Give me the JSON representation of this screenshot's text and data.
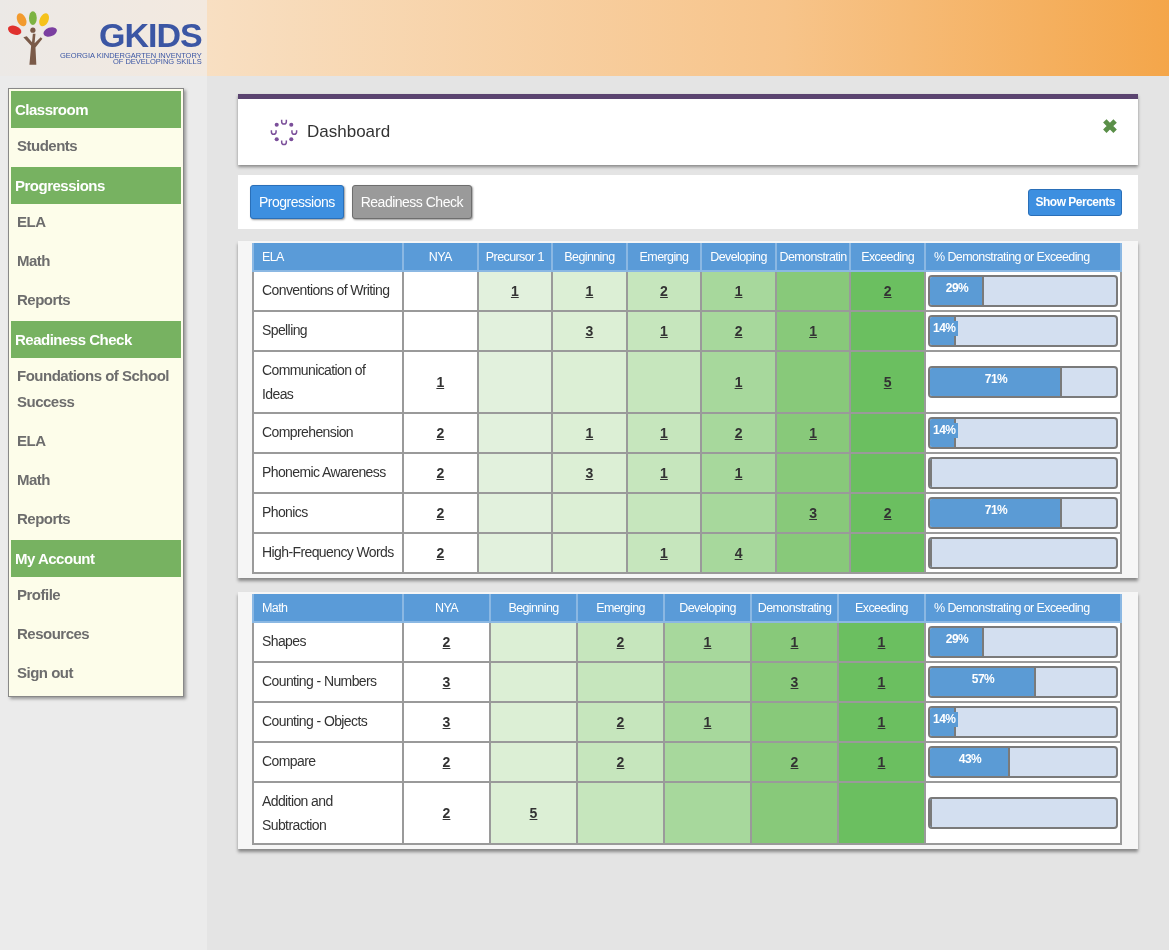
{
  "logo": {
    "title": "GKIDS",
    "subtitle": [
      "GEORGIA KINDERGARTEN INVENTORY",
      "OF DEVELOPING SKILLS"
    ]
  },
  "sidebar": {
    "items": [
      {
        "kind": "header",
        "label": "Classroom"
      },
      {
        "kind": "link",
        "label": "Students"
      },
      {
        "kind": "header",
        "label": "Progressions"
      },
      {
        "kind": "link",
        "label": "ELA"
      },
      {
        "kind": "link",
        "label": "Math"
      },
      {
        "kind": "link",
        "label": "Reports"
      },
      {
        "kind": "header",
        "label": "Readiness Check"
      },
      {
        "kind": "link",
        "label": "Foundations of School Success"
      },
      {
        "kind": "link",
        "label": "ELA"
      },
      {
        "kind": "link",
        "label": "Math"
      },
      {
        "kind": "link",
        "label": "Reports"
      },
      {
        "kind": "header",
        "label": "My Account"
      },
      {
        "kind": "link",
        "label": "Profile"
      },
      {
        "kind": "link",
        "label": "Resources"
      },
      {
        "kind": "link",
        "label": "Sign out"
      }
    ]
  },
  "panel": {
    "title": "Dashboard",
    "close": "✖"
  },
  "tabs": [
    {
      "label": "Progressions",
      "selected": true
    },
    {
      "label": "Readiness Check",
      "selected": false
    }
  ],
  "show_percents": "Show Percents",
  "tables": [
    {
      "columns": [
        "ELA",
        "NYA",
        "Precursor 1",
        "Beginning",
        "Emerging",
        "Developing",
        "Demonstratin",
        "Exceeding",
        "% Demonstrating or Exceeding"
      ],
      "rows": [
        {
          "cells": [
            "Conventions of Writing",
            null,
            "1",
            "1",
            "2",
            "1",
            null,
            "2"
          ],
          "percent": {
            "level": 0.29,
            "label": "29%"
          }
        },
        {
          "cells": [
            "Spelling",
            null,
            null,
            "3",
            "1",
            "2",
            "1",
            null
          ],
          "percent": {
            "level": 0.14,
            "label": "14%"
          }
        },
        {
          "cells": [
            "Communication of Ideas",
            "1",
            null,
            null,
            null,
            "1",
            null,
            "5"
          ],
          "percent": {
            "level": 0.71,
            "label": "71%"
          }
        },
        {
          "cells": [
            "Comprehension",
            "2",
            null,
            "1",
            "1",
            "2",
            "1",
            null
          ],
          "percent": {
            "level": 0.14,
            "label": "14%"
          }
        },
        {
          "cells": [
            "Phonemic Awareness",
            "2",
            null,
            "3",
            "1",
            "1",
            null,
            null
          ],
          "percent": {
            "level": 0
          }
        },
        {
          "cells": [
            "Phonics",
            "2",
            null,
            null,
            null,
            null,
            "3",
            "2"
          ],
          "percent": {
            "level": 0.71,
            "label": "71%"
          }
        },
        {
          "cells": [
            "High-Frequency Words",
            "2",
            null,
            null,
            "1",
            "4",
            null,
            null
          ],
          "percent": {
            "level": 0
          }
        }
      ]
    },
    {
      "columns": [
        "Math",
        "NYA",
        "Beginning",
        "Emerging",
        "Developing",
        "Demonstrating",
        "Exceeding",
        "% Demonstrating or Exceeding"
      ],
      "rows": [
        {
          "cells": [
            "Shapes",
            "2",
            null,
            "2",
            "1",
            "1",
            "1"
          ],
          "percent": {
            "level": 0.29,
            "label": "29%"
          }
        },
        {
          "cells": [
            "Counting - Numbers",
            "3",
            null,
            null,
            null,
            "3",
            "1"
          ],
          "percent": {
            "level": 0.57,
            "label": "57%"
          }
        },
        {
          "cells": [
            "Counting - Objects",
            "3",
            null,
            "2",
            "1",
            null,
            "1"
          ],
          "percent": {
            "level": 0.14,
            "label": "14%"
          }
        },
        {
          "cells": [
            "Compare",
            "2",
            null,
            "2",
            null,
            "2",
            "1"
          ],
          "percent": {
            "level": 0.43,
            "label": "43%"
          }
        },
        {
          "cells": [
            "Addition and Subtraction",
            "2",
            "5",
            null,
            null,
            null,
            null
          ],
          "percent": {
            "level": 0
          }
        }
      ]
    }
  ]
}
